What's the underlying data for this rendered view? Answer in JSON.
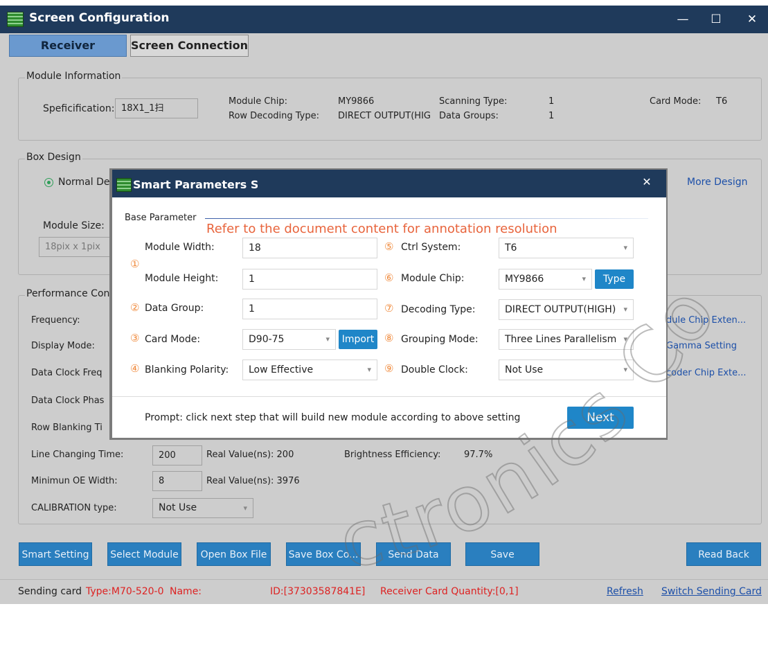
{
  "window": {
    "title": "Screen Configuration",
    "min_glyph": "—",
    "max_glyph": "☐",
    "close_glyph": "✕"
  },
  "tabs": [
    {
      "label": "Receiver",
      "active": true
    },
    {
      "label": "Screen Connection",
      "active": false
    }
  ],
  "module_info": {
    "title": "Module Information",
    "spec_label": "Speficification:",
    "spec_value": "18X1_1扫",
    "chip_label": "Module Chip:",
    "chip_value": "MY9866",
    "row_decoding_label": "Row Decoding Type:",
    "row_decoding_value": "DIRECT OUTPUT(HIG",
    "scanning_label": "Scanning Type:",
    "scanning_value": "1",
    "data_groups_label": "Data Groups:",
    "data_groups_value": "1",
    "card_mode_label": "Card Mode:",
    "card_mode_value": "T6"
  },
  "box_design": {
    "title": "Box Design",
    "normal_label": "Normal De",
    "more_design": "More Design",
    "module_size_label": "Module Size:",
    "module_size_value": "18pix x 1pix"
  },
  "performance": {
    "title": "Performance Con",
    "frequency_label": "Frequency:",
    "display_mode_label": "Display Mode:",
    "data_clock_freq_label": "Data Clock Freq",
    "data_clock_phase_label": "Data Clock Phas",
    "row_blanking_label": "Row Blanking Ti",
    "line_changing_label": "Line Changing Time:",
    "line_changing_value": "200",
    "line_real_label": "Real Value(ns): 200",
    "brightness_label": "Brightness Efficiency:",
    "brightness_value": "97.7%",
    "min_oe_label": "Minimun OE Width:",
    "min_oe_value": "8",
    "min_oe_real_label": "Real Value(ns): 3976",
    "calibration_label": "CALIBRATION type:",
    "calibration_value": "Not Use",
    "links": [
      "dule Chip Exten...",
      "Gamma Setting",
      "coder Chip Exte..."
    ]
  },
  "bottom_buttons": [
    "Smart Setting",
    "Select Module",
    "Open Box File",
    "Save Box Co...",
    "Send Data",
    "Save",
    "Read Back"
  ],
  "status": {
    "sending_card": "Sending card",
    "type": "Type:M70-520-0",
    "name": "Name:",
    "id": "ID:[37303587841E]",
    "receiver_qty": "Receiver Card Quantity:[0,1]",
    "refresh": "Refresh",
    "switch": "Switch Sending Card"
  },
  "dialog": {
    "title": "Smart Parameters Setting",
    "close_glyph": "✕",
    "base_parameter": "Base Parameter",
    "annotation": "Refer to the document content for annotation resolution",
    "circled": [
      "①",
      "②",
      "③",
      "④",
      "⑤",
      "⑥",
      "⑦",
      "⑧",
      "⑨"
    ],
    "module_width_label": "Module Width:",
    "module_width_value": "18",
    "module_height_label": "Module Height:",
    "module_height_value": "1",
    "data_group_label": "Data Group:",
    "data_group_value": "1",
    "card_mode_label": "Card Mode:",
    "card_mode_value": "D90-75",
    "import_label": "Import",
    "blanking_label": "Blanking Polarity:",
    "blanking_value": "Low Effective",
    "ctrl_system_label": "Ctrl System:",
    "ctrl_system_value": "T6",
    "module_chip_label": "Module Chip:",
    "module_chip_value": "MY9866",
    "type_label": "Type",
    "decoding_label": "Decoding Type:",
    "decoding_value": "DIRECT OUTPUT(HIGH)",
    "grouping_label": "Grouping Mode:",
    "grouping_value": "Three Lines Parallelism",
    "double_clock_label": "Double Clock:",
    "double_clock_value": "Not Use",
    "prompt": "Prompt: click next step that will build new module according to above setting",
    "next_label": "Next"
  },
  "watermark": "ctronics Co"
}
